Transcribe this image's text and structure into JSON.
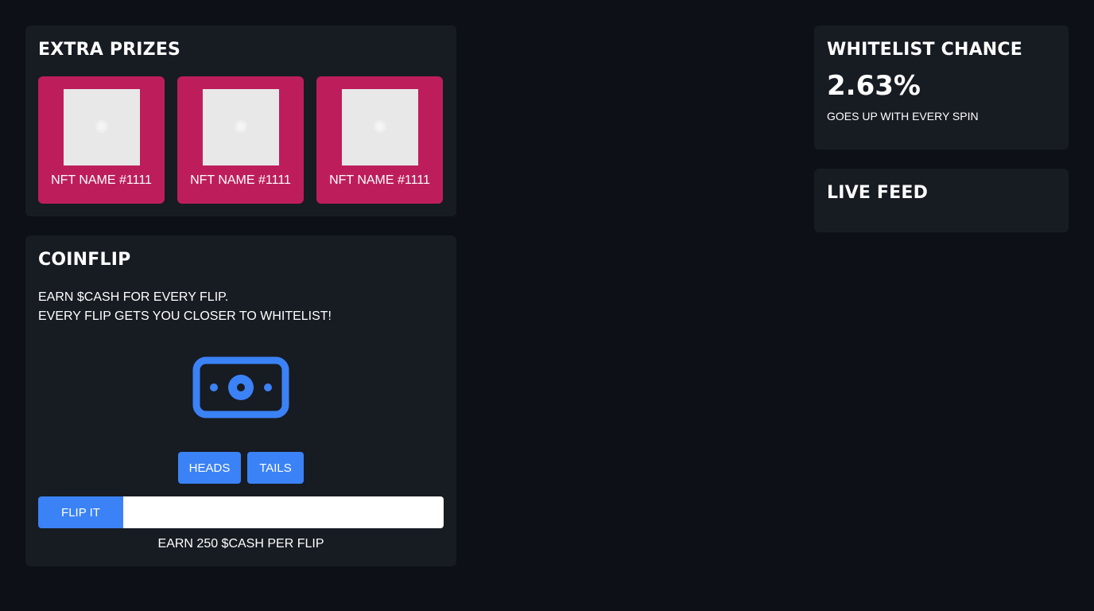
{
  "extra_prizes": {
    "title": "EXTRA PRIZES",
    "items": [
      {
        "name": "NFT NAME #1111"
      },
      {
        "name": "NFT NAME #1111"
      },
      {
        "name": "NFT NAME #1111"
      }
    ]
  },
  "coinflip": {
    "title": "COINFLIP",
    "description_line1": "EARN $CASH FOR EVERY FLIP.",
    "description_line2": "EVERY FLIP GETS YOU CLOSER TO WHITELIST!",
    "icon": "cash-icon",
    "heads_label": "HEADS",
    "tails_label": "TAILS",
    "flip_label": "FLIP IT",
    "input_value": "",
    "earn_note": "EARN 250 $CASH PER FLIP"
  },
  "whitelist": {
    "title": "WHITELIST CHANCE",
    "value": "2.63%",
    "subtitle": "GOES UP WITH EVERY SPIN"
  },
  "live_feed": {
    "title": "LIVE FEED"
  },
  "colors": {
    "background": "#0d1017",
    "card": "#171b22",
    "prize_card": "#bd1e5b",
    "accent": "#3b82f6"
  }
}
